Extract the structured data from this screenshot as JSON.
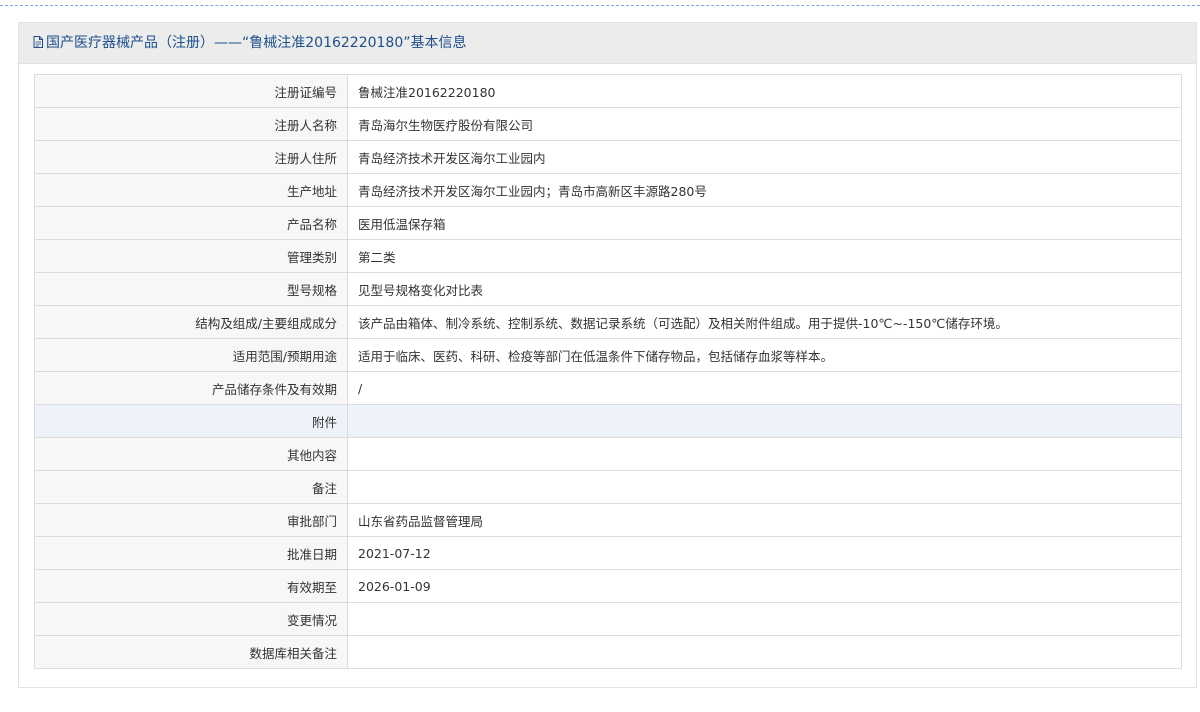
{
  "header": {
    "title": "国产医疗器械产品（注册）——“鲁械注准20162220180”基本信息"
  },
  "rows": [
    {
      "label": "注册证编号",
      "value": "鲁械注准20162220180"
    },
    {
      "label": "注册人名称",
      "value": "青岛海尔生物医疗股份有限公司"
    },
    {
      "label": "注册人住所",
      "value": "青岛经济技术开发区海尔工业园内"
    },
    {
      "label": "生产地址",
      "value": "青岛经济技术开发区海尔工业园内；青岛市高新区丰源路280号"
    },
    {
      "label": "产品名称",
      "value": "医用低温保存箱"
    },
    {
      "label": "管理类别",
      "value": "第二类"
    },
    {
      "label": "型号规格",
      "value": "见型号规格变化对比表"
    },
    {
      "label": "结构及组成/主要组成成分",
      "value": "该产品由箱体、制冷系统、控制系统、数据记录系统（可选配）及相关附件组成。用于提供-10℃~-150℃储存环境。"
    },
    {
      "label": "适用范围/预期用途",
      "value": "适用于临床、医药、科研、检疫等部门在低温条件下储存物品，包括储存血浆等样本。"
    },
    {
      "label": "产品储存条件及有效期",
      "value": "/"
    },
    {
      "label": "附件",
      "value": ""
    },
    {
      "label": "其他内容",
      "value": ""
    },
    {
      "label": "备注",
      "value": ""
    },
    {
      "label": "审批部门",
      "value": "山东省药品监督管理局"
    },
    {
      "label": "批准日期",
      "value": "2021-07-12"
    },
    {
      "label": "有效期至",
      "value": "2026-01-09"
    },
    {
      "label": "变更情况",
      "value": ""
    },
    {
      "label": "数据库相关备注",
      "value": ""
    }
  ],
  "highlighted_row": 10,
  "colors": {
    "header_text": "#1d4f8c",
    "row_highlight": "#eef3f9"
  },
  "icons": {
    "header": "document-icon"
  }
}
